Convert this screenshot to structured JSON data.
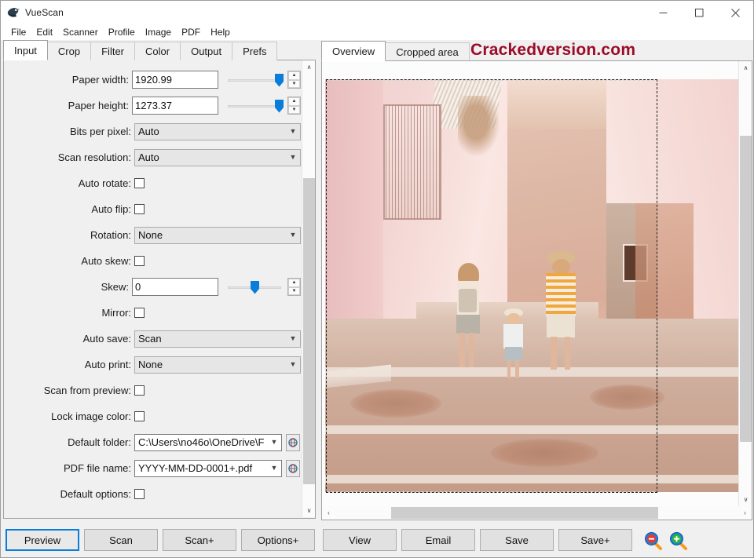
{
  "window": {
    "title": "VueScan",
    "app_icon": "vuescan-icon",
    "controls": {
      "minimize": "─",
      "maximize": "☐",
      "close": "✕"
    }
  },
  "menubar": {
    "items": [
      "File",
      "Edit",
      "Scanner",
      "Profile",
      "Image",
      "PDF",
      "Help"
    ]
  },
  "left_tabs": {
    "items": [
      "Input",
      "Crop",
      "Filter",
      "Color",
      "Output",
      "Prefs"
    ],
    "active": "Input"
  },
  "input_form": {
    "rows": [
      {
        "label": "Paper width:",
        "type": "text-slider-spin",
        "value": "1920.99",
        "thumb_pct": 96
      },
      {
        "label": "Paper height:",
        "type": "text-slider-spin",
        "value": "1273.37",
        "thumb_pct": 96
      },
      {
        "label": "Bits per pixel:",
        "type": "combo",
        "value": "Auto"
      },
      {
        "label": "Scan resolution:",
        "type": "combo",
        "value": "Auto"
      },
      {
        "label": "Auto rotate:",
        "type": "checkbox",
        "checked": false
      },
      {
        "label": "Auto flip:",
        "type": "checkbox",
        "checked": false
      },
      {
        "label": "Rotation:",
        "type": "combo",
        "value": "None"
      },
      {
        "label": "Auto skew:",
        "type": "checkbox",
        "checked": false
      },
      {
        "label": "Skew:",
        "type": "text-slider-spin",
        "value": "0",
        "thumb_pct": 50
      },
      {
        "label": "Mirror:",
        "type": "checkbox",
        "checked": false
      },
      {
        "label": "Auto save:",
        "type": "combo",
        "value": "Scan"
      },
      {
        "label": "Auto print:",
        "type": "combo",
        "value": "None"
      },
      {
        "label": "Scan from preview:",
        "type": "checkbox",
        "checked": false
      },
      {
        "label": "Lock image color:",
        "type": "checkbox",
        "checked": false
      },
      {
        "label": "Default folder:",
        "type": "combo-at",
        "value": "C:\\Users\\no46o\\OneDrive\\F"
      },
      {
        "label": "PDF file name:",
        "type": "combo-at",
        "value": "YYYY-MM-DD-0001+.pdf"
      },
      {
        "label": "Default options:",
        "type": "checkbox",
        "checked": false
      }
    ],
    "at_button_icon": "browse-globe-icon"
  },
  "preview": {
    "tabs": [
      "Overview",
      "Cropped area"
    ],
    "active_tab": "Overview",
    "watermark": "Crackedversion.com",
    "image_alt": "family-walking-in-pink-alley-photo",
    "crop_marquee": "dashed-crop-selection"
  },
  "scrollbars": {
    "up_arrow": "∧",
    "down_arrow": "∨",
    "left_arrow": "‹",
    "right_arrow": "›"
  },
  "button_bar": {
    "buttons": [
      {
        "label": "Preview",
        "focused": true
      },
      {
        "label": "Scan",
        "focused": false
      },
      {
        "label": "Scan+",
        "focused": false
      },
      {
        "label": "Options+",
        "focused": false
      },
      {
        "label": "View",
        "focused": false
      },
      {
        "label": "Email",
        "focused": false
      },
      {
        "label": "Save",
        "focused": false
      },
      {
        "label": "Save+",
        "focused": false
      }
    ],
    "zoom_out_icon": "zoom-out-magnifier-icon",
    "zoom_in_icon": "zoom-in-magnifier-icon"
  },
  "colors": {
    "accent_blue": "#0a7ddb",
    "watermark_red": "#9c0c29",
    "panel_bg": "#f0f0f0",
    "zoom_out_red": "#e53935",
    "zoom_in_green": "#2eb82e",
    "magnifier_handle": "#f79b1e"
  }
}
